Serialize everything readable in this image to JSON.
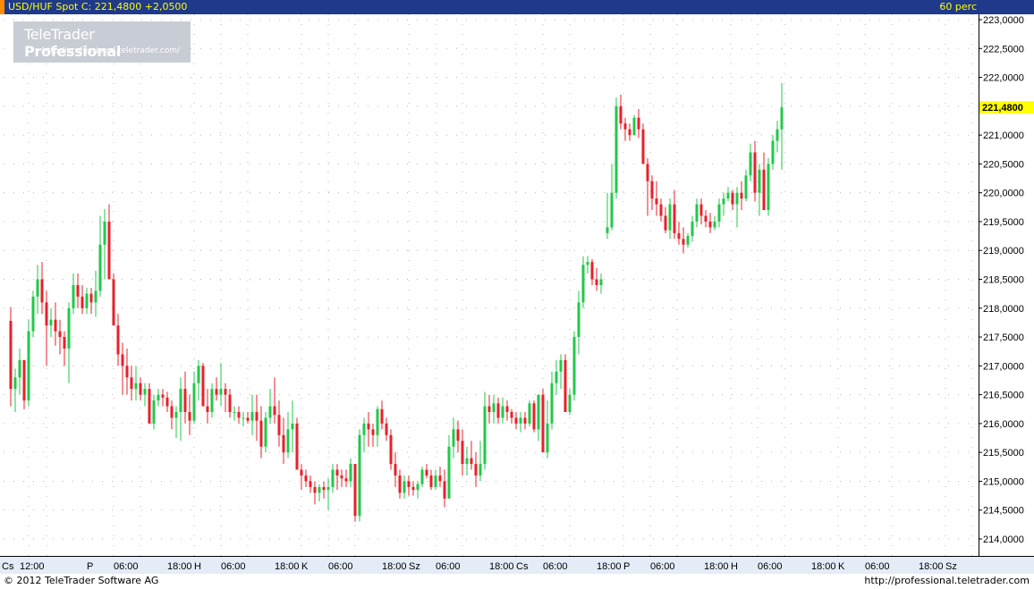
{
  "header": {
    "title": "USD/HUF Spot  C: 221,4800  +2,0500",
    "period": "60 perc"
  },
  "logo": {
    "brand_light": "TeleTrader ",
    "brand_bold": "Professional",
    "url": "http://professional.teletrader.com/"
  },
  "footer": {
    "copyright": "© 2012  TeleTrader Software AG",
    "site": "http://professional.teletrader.com"
  },
  "colors": {
    "up": "#22c84a",
    "down": "#e8202a",
    "header_bg": "#1f3a8a",
    "price_marker": "#ffff00"
  },
  "chart_data": {
    "type": "candlestick",
    "instrument": "USD/HUF Spot",
    "close": 221.48,
    "change": 2.05,
    "ylim": [
      213.7,
      223.2
    ],
    "grid": true,
    "y_ticks": [
      "223,0000",
      "222,5000",
      "222,0000",
      "221,5000",
      "221,0000",
      "220,5000",
      "220,0000",
      "219,5000",
      "219,0000",
      "218,5000",
      "218,0000",
      "217,5000",
      "217,0000",
      "216,5000",
      "216,0000",
      "215,5000",
      "215,0000",
      "214,5000",
      "214,0000"
    ],
    "last_price_label": "221,4800",
    "x_ticks": [
      {
        "label": "Cs",
        "i": 0
      },
      {
        "label": "12:00",
        "i": 4
      },
      {
        "label": "P",
        "i": 19
      },
      {
        "label": "06:00",
        "i": 25
      },
      {
        "label": "18:00",
        "i": 37
      },
      {
        "label": "H",
        "i": 43
      },
      {
        "label": "06:00",
        "i": 49
      },
      {
        "label": "18:00",
        "i": 61
      },
      {
        "label": "K",
        "i": 67
      },
      {
        "label": "06:00",
        "i": 73
      },
      {
        "label": "18:00",
        "i": 85
      },
      {
        "label": "Sz",
        "i": 91
      },
      {
        "label": "06:00",
        "i": 97
      },
      {
        "label": "18:00",
        "i": 109
      },
      {
        "label": "Cs",
        "i": 115
      },
      {
        "label": "06:00",
        "i": 121
      },
      {
        "label": "18:00",
        "i": 133
      },
      {
        "label": "P",
        "i": 139
      },
      {
        "label": "06:00",
        "i": 145
      },
      {
        "label": "18:00",
        "i": 157
      },
      {
        "label": "H",
        "i": 163
      },
      {
        "label": "06:00",
        "i": 169
      },
      {
        "label": "18:00",
        "i": 181
      },
      {
        "label": "K",
        "i": 187
      },
      {
        "label": "06:00",
        "i": 193
      },
      {
        "label": "18:00",
        "i": 205
      },
      {
        "label": "Sz",
        "i": 211
      }
    ],
    "candles": [
      [
        217.78,
        218.02,
        216.3,
        216.6
      ],
      [
        216.6,
        216.95,
        216.2,
        216.8
      ],
      [
        216.8,
        217.3,
        216.5,
        217.1
      ],
      [
        217.1,
        217.1,
        216.25,
        216.4
      ],
      [
        216.4,
        217.8,
        216.3,
        217.6
      ],
      [
        217.6,
        218.3,
        217.5,
        218.2
      ],
      [
        218.2,
        218.75,
        217.9,
        218.5
      ],
      [
        218.5,
        218.8,
        217.9,
        218.1
      ],
      [
        218.1,
        218.3,
        217.0,
        217.7
      ],
      [
        217.7,
        218.0,
        217.5,
        217.8
      ],
      [
        217.8,
        218.1,
        217.35,
        217.6
      ],
      [
        217.6,
        217.8,
        217.2,
        217.5
      ],
      [
        217.5,
        217.6,
        217.0,
        217.3
      ],
      [
        217.3,
        218.1,
        216.7,
        218.0
      ],
      [
        218.0,
        218.6,
        217.9,
        218.4
      ],
      [
        218.4,
        218.6,
        218.0,
        218.2
      ],
      [
        218.2,
        218.4,
        217.9,
        218.0
      ],
      [
        218.0,
        218.35,
        217.9,
        218.25
      ],
      [
        218.25,
        218.35,
        217.9,
        218.1
      ],
      [
        218.1,
        218.65,
        217.85,
        218.3
      ],
      [
        218.3,
        219.6,
        218.2,
        219.1
      ],
      [
        219.1,
        219.72,
        218.5,
        219.5
      ],
      [
        219.5,
        219.8,
        218.7,
        218.5
      ],
      [
        218.5,
        218.6,
        217.7,
        217.7
      ],
      [
        217.7,
        217.9,
        217.0,
        217.2
      ],
      [
        217.2,
        217.4,
        216.5,
        217.0
      ],
      [
        217.0,
        217.3,
        216.5,
        216.8
      ],
      [
        216.8,
        217.0,
        216.4,
        216.6
      ],
      [
        216.6,
        217.0,
        216.4,
        216.7
      ],
      [
        216.7,
        216.8,
        216.4,
        216.5
      ],
      [
        216.5,
        216.7,
        216.3,
        216.6
      ],
      [
        216.6,
        216.7,
        216.0,
        216.0
      ],
      [
        216.0,
        216.5,
        215.9,
        216.4
      ],
      [
        216.4,
        216.6,
        216.3,
        216.5
      ],
      [
        216.5,
        216.6,
        216.3,
        216.45
      ],
      [
        216.45,
        216.55,
        216.2,
        216.3
      ],
      [
        216.3,
        216.4,
        215.9,
        216.1
      ],
      [
        216.1,
        216.3,
        215.75,
        216.2
      ],
      [
        216.2,
        216.8,
        215.7,
        216.6
      ],
      [
        216.6,
        216.9,
        216.0,
        216.2
      ],
      [
        216.2,
        216.5,
        215.8,
        216.05
      ],
      [
        216.05,
        216.9,
        216.0,
        216.7
      ],
      [
        216.7,
        217.1,
        216.4,
        217.0
      ],
      [
        217.0,
        217.05,
        216.3,
        216.3
      ],
      [
        216.3,
        216.6,
        216.0,
        216.2
      ],
      [
        216.2,
        216.7,
        216.1,
        216.6
      ],
      [
        216.6,
        216.8,
        216.4,
        216.5
      ],
      [
        216.5,
        217.05,
        216.3,
        216.6
      ],
      [
        216.6,
        216.7,
        216.2,
        216.5
      ],
      [
        216.5,
        216.6,
        216.1,
        216.2
      ],
      [
        216.2,
        216.3,
        216.05,
        216.2
      ],
      [
        216.2,
        216.3,
        216.0,
        216.1
      ],
      [
        216.1,
        216.2,
        215.95,
        216.1
      ],
      [
        216.1,
        216.2,
        216.0,
        216.05
      ],
      [
        216.05,
        216.5,
        215.8,
        216.2
      ],
      [
        216.2,
        216.5,
        215.7,
        216.05
      ],
      [
        216.05,
        216.3,
        215.4,
        215.6
      ],
      [
        215.6,
        216.2,
        215.5,
        216.1
      ],
      [
        216.1,
        216.6,
        216.0,
        216.3
      ],
      [
        216.3,
        216.8,
        216.0,
        216.15
      ],
      [
        216.15,
        216.4,
        215.6,
        215.8
      ],
      [
        215.8,
        216.1,
        215.3,
        215.5
      ],
      [
        215.5,
        216.2,
        215.4,
        215.9
      ],
      [
        215.9,
        216.4,
        215.5,
        216.0
      ],
      [
        216.0,
        216.1,
        215.2,
        215.2
      ],
      [
        215.2,
        215.3,
        214.85,
        215.1
      ],
      [
        215.1,
        215.2,
        214.9,
        215.0
      ],
      [
        215.0,
        215.1,
        214.8,
        214.9
      ],
      [
        214.9,
        215.0,
        214.6,
        214.8
      ],
      [
        214.8,
        214.95,
        214.65,
        214.9
      ],
      [
        214.9,
        215.0,
        214.7,
        214.85
      ],
      [
        214.85,
        215.05,
        214.5,
        214.9
      ],
      [
        214.9,
        215.3,
        214.8,
        215.2
      ],
      [
        215.2,
        215.3,
        214.85,
        215.1
      ],
      [
        215.1,
        215.2,
        214.9,
        215.05
      ],
      [
        215.05,
        215.2,
        214.9,
        215.0
      ],
      [
        215.0,
        215.4,
        214.9,
        215.3
      ],
      [
        215.3,
        215.3,
        214.3,
        214.4
      ],
      [
        214.4,
        215.9,
        214.3,
        215.8
      ],
      [
        215.8,
        216.1,
        215.5,
        216.0
      ],
      [
        216.0,
        216.2,
        215.6,
        215.9
      ],
      [
        215.9,
        216.0,
        215.6,
        215.8
      ],
      [
        215.8,
        216.3,
        215.6,
        216.25
      ],
      [
        216.25,
        216.4,
        215.9,
        216.0
      ],
      [
        216.0,
        216.1,
        215.7,
        215.8
      ],
      [
        215.8,
        215.9,
        215.2,
        215.3
      ],
      [
        215.3,
        215.5,
        214.9,
        215.1
      ],
      [
        215.1,
        215.2,
        214.7,
        214.8
      ],
      [
        214.8,
        215.1,
        214.7,
        215.0
      ],
      [
        215.0,
        215.1,
        214.75,
        214.9
      ],
      [
        214.9,
        215.0,
        214.75,
        214.85
      ],
      [
        214.85,
        215.0,
        214.7,
        214.95
      ],
      [
        214.95,
        215.25,
        214.9,
        215.2
      ],
      [
        215.2,
        215.3,
        215.05,
        215.1
      ],
      [
        215.1,
        215.2,
        214.85,
        214.9
      ],
      [
        214.9,
        215.2,
        214.85,
        215.1
      ],
      [
        215.1,
        215.25,
        214.9,
        215.0
      ],
      [
        215.0,
        215.2,
        214.55,
        214.7
      ],
      [
        214.7,
        215.8,
        214.7,
        215.6
      ],
      [
        215.6,
        216.1,
        215.4,
        215.9
      ],
      [
        215.9,
        216.05,
        215.5,
        215.7
      ],
      [
        215.7,
        215.9,
        215.1,
        215.3
      ],
      [
        215.3,
        215.6,
        215.1,
        215.4
      ],
      [
        215.4,
        215.7,
        215.2,
        215.3
      ],
      [
        215.3,
        215.5,
        214.9,
        215.1
      ],
      [
        215.1,
        215.7,
        215.0,
        215.3
      ],
      [
        215.3,
        216.55,
        215.2,
        216.3
      ],
      [
        216.3,
        216.5,
        216.0,
        216.2
      ],
      [
        216.2,
        216.5,
        216.0,
        216.35
      ],
      [
        216.35,
        216.45,
        216.0,
        216.1
      ],
      [
        216.1,
        216.45,
        216.0,
        216.3
      ],
      [
        216.3,
        216.4,
        216.05,
        216.2
      ],
      [
        216.2,
        216.25,
        216.0,
        216.1
      ],
      [
        216.1,
        216.2,
        215.9,
        216.0
      ],
      [
        216.0,
        216.2,
        215.85,
        216.1
      ],
      [
        216.1,
        216.2,
        215.9,
        216.0
      ],
      [
        216.0,
        216.4,
        215.95,
        216.35
      ],
      [
        216.35,
        216.4,
        215.85,
        215.9
      ],
      [
        215.9,
        216.5,
        215.7,
        216.5
      ],
      [
        216.5,
        216.6,
        215.6,
        215.5
      ],
      [
        215.5,
        216.4,
        215.4,
        216.0
      ],
      [
        216.0,
        216.9,
        215.9,
        216.7
      ],
      [
        216.7,
        217.1,
        216.5,
        216.9
      ],
      [
        216.9,
        217.2,
        216.6,
        217.1
      ],
      [
        217.1,
        217.2,
        216.3,
        216.2
      ],
      [
        216.2,
        216.6,
        216.15,
        216.5
      ],
      [
        216.5,
        217.6,
        216.4,
        217.5
      ],
      [
        217.5,
        218.3,
        217.2,
        218.1
      ],
      [
        218.1,
        218.9,
        218.0,
        218.75
      ],
      [
        218.75,
        218.9,
        218.6,
        218.8
      ],
      [
        218.8,
        218.85,
        218.4,
        218.5
      ],
      [
        218.5,
        218.7,
        218.3,
        218.4
      ],
      [
        218.4,
        218.6,
        218.25,
        218.5
      ]
    ],
    "candles_after_gap": [
      [
        219.3,
        220.0,
        219.2,
        219.4
      ],
      [
        219.4,
        220.5,
        219.35,
        220.0
      ],
      [
        220.0,
        221.65,
        219.9,
        221.5
      ],
      [
        221.5,
        221.7,
        221.1,
        221.2
      ],
      [
        221.2,
        221.3,
        220.9,
        221.1
      ],
      [
        221.1,
        221.2,
        220.9,
        221.0
      ],
      [
        221.0,
        221.35,
        221.0,
        221.3
      ],
      [
        221.3,
        221.45,
        220.95,
        221.1
      ],
      [
        221.1,
        221.2,
        220.5,
        220.5
      ],
      [
        220.5,
        220.6,
        219.6,
        220.2
      ],
      [
        220.2,
        220.3,
        219.7,
        219.9
      ],
      [
        219.9,
        220.2,
        219.6,
        219.8
      ],
      [
        219.8,
        219.9,
        219.5,
        219.6
      ],
      [
        219.6,
        219.75,
        219.3,
        219.35
      ],
      [
        219.35,
        219.9,
        219.2,
        219.8
      ],
      [
        219.8,
        220.05,
        219.2,
        219.3
      ],
      [
        219.3,
        219.5,
        219.1,
        219.2
      ],
      [
        219.2,
        219.4,
        218.95,
        219.1
      ],
      [
        219.1,
        219.3,
        219.05,
        219.25
      ],
      [
        219.25,
        219.6,
        219.15,
        219.5
      ],
      [
        219.5,
        219.9,
        219.4,
        219.8
      ],
      [
        219.8,
        219.9,
        219.45,
        219.6
      ],
      [
        219.6,
        219.7,
        219.4,
        219.5
      ],
      [
        219.5,
        219.65,
        219.3,
        219.4
      ],
      [
        219.4,
        219.6,
        219.35,
        219.5
      ],
      [
        219.5,
        219.9,
        219.4,
        219.8
      ],
      [
        219.8,
        220.0,
        219.6,
        219.9
      ],
      [
        219.9,
        220.1,
        219.85,
        220.0
      ],
      [
        220.0,
        220.05,
        219.7,
        219.8
      ],
      [
        219.8,
        220.1,
        219.4,
        220.0
      ],
      [
        220.0,
        220.2,
        219.7,
        219.9
      ],
      [
        219.9,
        220.4,
        219.85,
        220.3
      ],
      [
        220.3,
        220.85,
        220.2,
        220.7
      ],
      [
        220.7,
        220.9,
        219.85,
        220.0
      ],
      [
        220.0,
        220.5,
        219.6,
        220.4
      ],
      [
        220.4,
        220.7,
        219.8,
        219.7
      ],
      [
        219.7,
        220.6,
        219.6,
        220.5
      ],
      [
        220.5,
        221.0,
        220.4,
        220.9
      ],
      [
        220.9,
        221.25,
        220.7,
        221.1
      ],
      [
        221.1,
        221.9,
        220.4,
        221.48
      ]
    ]
  }
}
